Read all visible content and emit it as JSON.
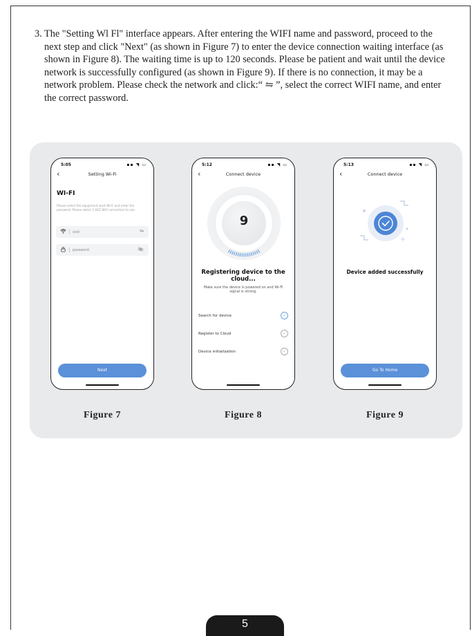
{
  "instructions": {
    "step": "3.",
    "text": "The \"Setting Wl Fl\" interface appears. After entering the WIFI name and password, proceed to the next step and click \"Next\" (as shown in Figure 7) to enter the device connection waiting interface (as shown in Figure 8). The waiting time is up to 120 seconds. Please be patient and wait until the device network is successfully configured (as shown in Figure 9). If there is no connection, it may be a network problem. Please check the network and click:“ ⇋ ”, select the correct WIFI name, and enter the correct password."
  },
  "figures": [
    {
      "caption": "Figure 7",
      "time": "5:05",
      "status": "▪▪ ◥ ▭",
      "title": "Setting  Wi-Fi",
      "heading": "WI-FI",
      "hint": "Please select the equipment work Wi-Fi and enter the password. Please select 2.4GZ WiFi connection to use.",
      "ssid_placeholder": "ssid",
      "password_placeholder": "password",
      "button": "Next"
    },
    {
      "caption": "Figure 8",
      "time": "5:12",
      "status": "▪▪ ◥ ▭",
      "title": "Connect device",
      "countdown": "9",
      "heading": "Registering device to the cloud...",
      "subtext": "Make sure the device is powered on and Wi-Fi signal is strong.",
      "steps": [
        {
          "label": "Search for device",
          "done": true
        },
        {
          "label": "Register to Cloud",
          "done": false
        },
        {
          "label": "Device initialization",
          "done": false
        }
      ]
    },
    {
      "caption": "Figure 9",
      "time": "5:13",
      "status": "▪▪ ◥ ▭",
      "title": "Connect device",
      "message": "Device added successfully",
      "button": "Go To Home"
    }
  ],
  "page_number": "5",
  "icons": {
    "back": "chevron-left-icon",
    "wifi": "wifi-icon",
    "lock": "lock-icon",
    "swap": "swap-icon",
    "eye_off": "eye-off-icon",
    "check": "check-circle-icon"
  },
  "colors": {
    "accent": "#5b91d8",
    "panel": "#e9eaeb",
    "check_on": "#6aa3e0"
  }
}
